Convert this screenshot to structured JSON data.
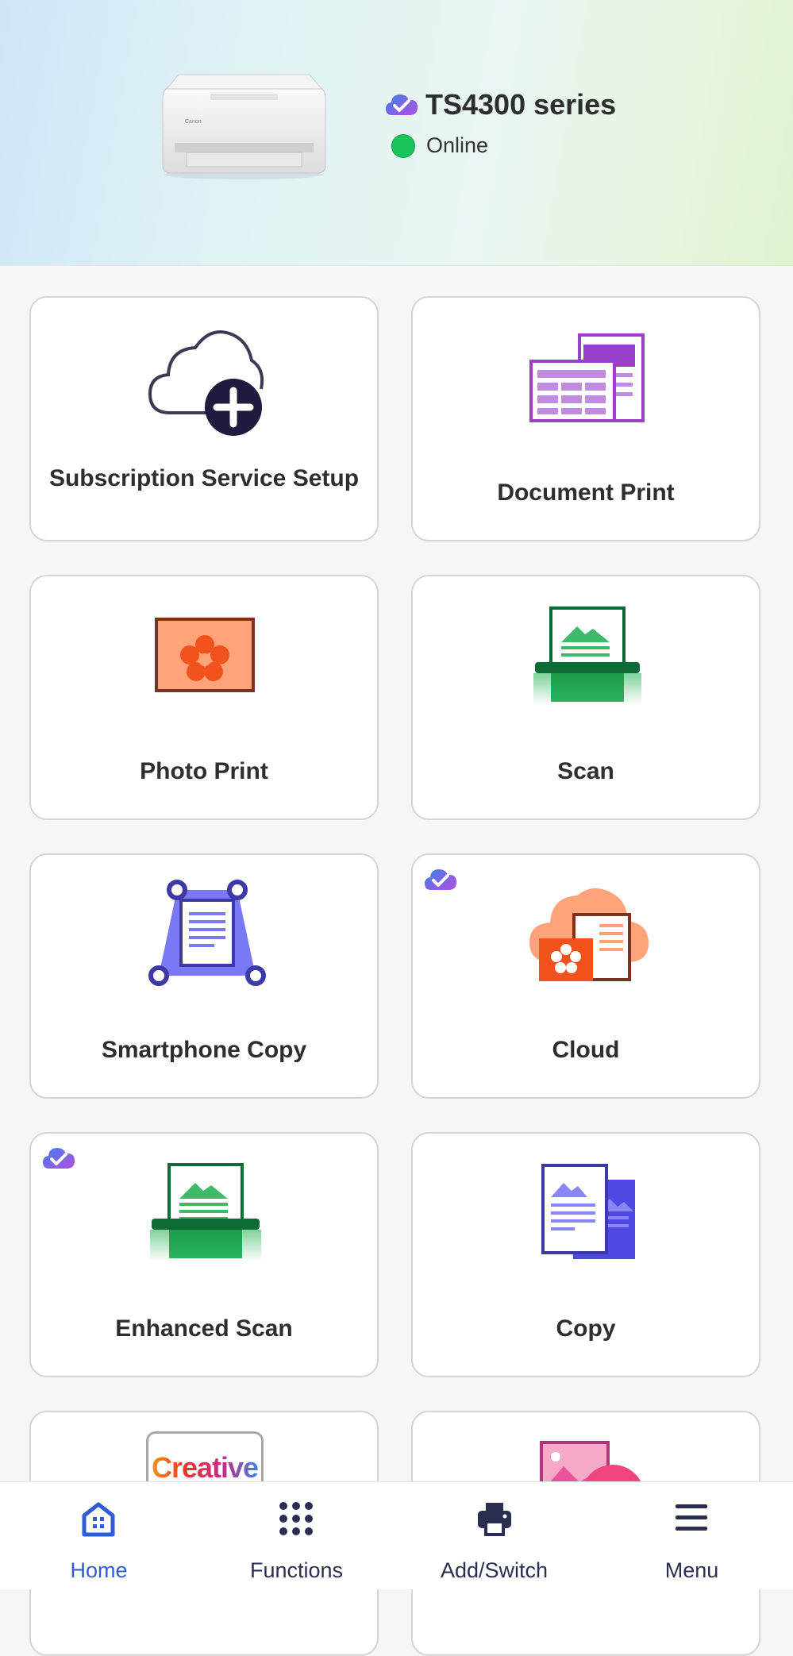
{
  "header": {
    "printer_name": "TS4300 series",
    "status": "Online",
    "status_color": "#19c35a",
    "cloud_badge_icon": "cloud-check-icon"
  },
  "tiles": [
    {
      "label": "Subscription Service Setup",
      "icon": "cloud-plus-icon"
    },
    {
      "label": "Document Print",
      "icon": "document-print-icon"
    },
    {
      "label": "Photo Print",
      "icon": "photo-print-icon"
    },
    {
      "label": "Scan",
      "icon": "scanner-icon"
    },
    {
      "label": "Smartphone Copy",
      "icon": "smartphone-copy-icon"
    },
    {
      "label": "Cloud",
      "icon": "cloud-icon",
      "badge": "cloud-check-icon"
    },
    {
      "label": "Enhanced Scan",
      "icon": "scanner-icon",
      "badge": "cloud-check-icon"
    },
    {
      "label": "Copy",
      "icon": "copy-icon"
    },
    {
      "label": "Creative",
      "icon": "creative-park-icon"
    },
    {
      "label": "",
      "icon": "photo-layout-icon"
    }
  ],
  "nav": {
    "items": [
      {
        "label": "Home",
        "icon": "home-icon",
        "active": true
      },
      {
        "label": "Functions",
        "icon": "grid-dots-icon",
        "active": false
      },
      {
        "label": "Add/Switch",
        "icon": "printer-icon",
        "active": false
      },
      {
        "label": "Menu",
        "icon": "hamburger-menu-icon",
        "active": false
      }
    ],
    "active_color": "#2e5bd6",
    "inactive_color": "#2a2f52"
  }
}
